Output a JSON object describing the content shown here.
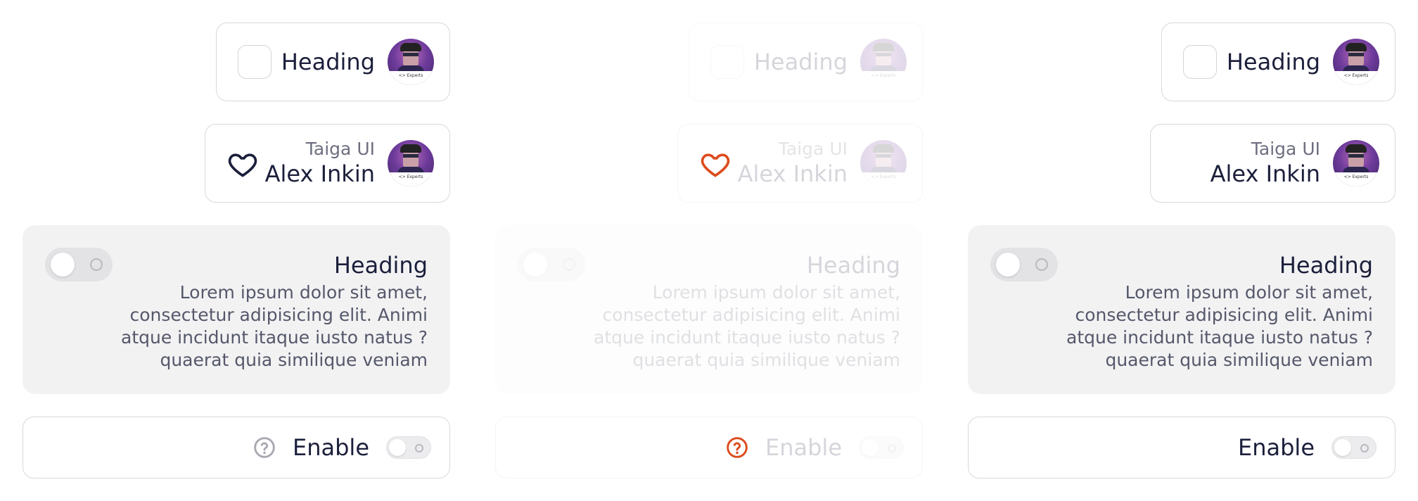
{
  "accent_color": "#dd4c1e",
  "text_color": "#1b1f3b",
  "columns": [
    {
      "state": "normal",
      "heading_card": {
        "title": "Heading"
      },
      "profile_card": {
        "subtitle": "Taiga UI",
        "name": "Alex Inkin",
        "icon": "heart-icon"
      },
      "big_card": {
        "title": "Heading",
        "description": "Lorem ipsum dolor sit amet, consectetur adipisicing elit. Animi atque incidunt itaque iusto natus ?quaerat quia similique veniam"
      },
      "enable_card": {
        "label": "Enable",
        "icon": "help-icon"
      }
    },
    {
      "state": "disabled",
      "heading_card": {
        "title": "Heading"
      },
      "profile_card": {
        "subtitle": "Taiga UI",
        "name": "Alex Inkin",
        "icon": "heart-icon"
      },
      "big_card": {
        "title": "Heading",
        "description": "Lorem ipsum dolor sit amet, consectetur adipisicing elit. Animi atque incidunt itaque iusto natus ?quaerat quia similique veniam"
      },
      "enable_card": {
        "label": "Enable",
        "icon": "help-icon"
      }
    },
    {
      "state": "normal-no-icons",
      "heading_card": {
        "title": "Heading"
      },
      "profile_card": {
        "subtitle": "Taiga UI",
        "name": "Alex Inkin"
      },
      "big_card": {
        "title": "Heading",
        "description": "Lorem ipsum dolor sit amet, consectetur adipisicing elit. Animi atque incidunt itaque iusto natus ?quaerat quia similique veniam"
      },
      "enable_card": {
        "label": "Enable"
      }
    }
  ]
}
